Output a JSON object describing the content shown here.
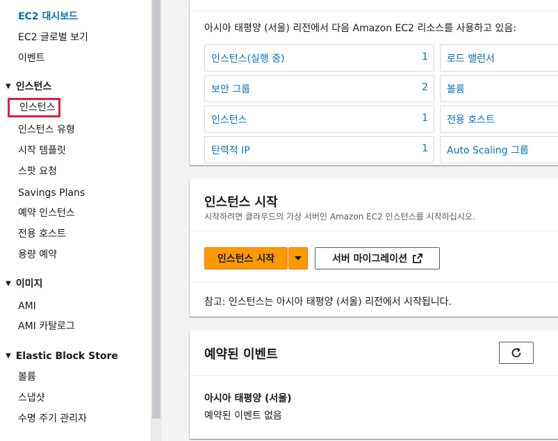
{
  "sidebar": {
    "dashboard": "EC2 대시보드",
    "global_view": "EC2 글로벌 보기",
    "events": "이벤트",
    "instances_section": "인스턴스",
    "instances": "인스턴스",
    "instance_types": "인스턴스 유형",
    "launch_templates": "시작 템플릿",
    "spot_requests": "스팟 요청",
    "savings_plans": "Savings Plans",
    "reserved_instances": "예약 인스턴스",
    "dedicated_hosts": "전용 호스트",
    "capacity_reservations": "용량 예약",
    "images_section": "이미지",
    "ami": "AMI",
    "ami_catalog": "AMI 카탈로그",
    "ebs_section": "Elastic Block Store",
    "volumes": "볼륨",
    "snapshots": "스냅샷",
    "lifecycle_manager": "수명 주기 관리자"
  },
  "resources": {
    "intro": "아시아 태평양 (서울) 리전에서 다음 Amazon EC2 리소스를 사용하고 있음:",
    "left": [
      {
        "label": "인스턴스(실행 중)",
        "count": "1"
      },
      {
        "label": "보안 그룹",
        "count": "2"
      },
      {
        "label": "인스턴스",
        "count": "1"
      },
      {
        "label": "탄력적 IP",
        "count": "1"
      }
    ],
    "right": [
      {
        "label": "로드 밸런서"
      },
      {
        "label": "볼륨"
      },
      {
        "label": "전용 호스트"
      },
      {
        "label": "Auto Scaling 그룹"
      }
    ]
  },
  "launch": {
    "title": "인스턴스 시작",
    "description": "시작하려면 클라우드의 가상 서버인 Amazon EC2 인스턴스를 시작하십시오.",
    "launch_button": "인스턴스 시작",
    "migrate_button": "서버 마이그레이션",
    "note": "참고: 인스턴스는 아시아 태평양 (서울) 리전에서 시작됩니다."
  },
  "events": {
    "title": "예약된 이벤트",
    "region": "아시아 태평양 (서울)",
    "empty": "예약된 이벤트 없음"
  },
  "colors": {
    "link": "#0073bb",
    "primary": "#ff9900",
    "highlight_box": "#e01e37"
  },
  "icons": [
    "caret-down-icon",
    "external-link-icon",
    "refresh-icon"
  ]
}
